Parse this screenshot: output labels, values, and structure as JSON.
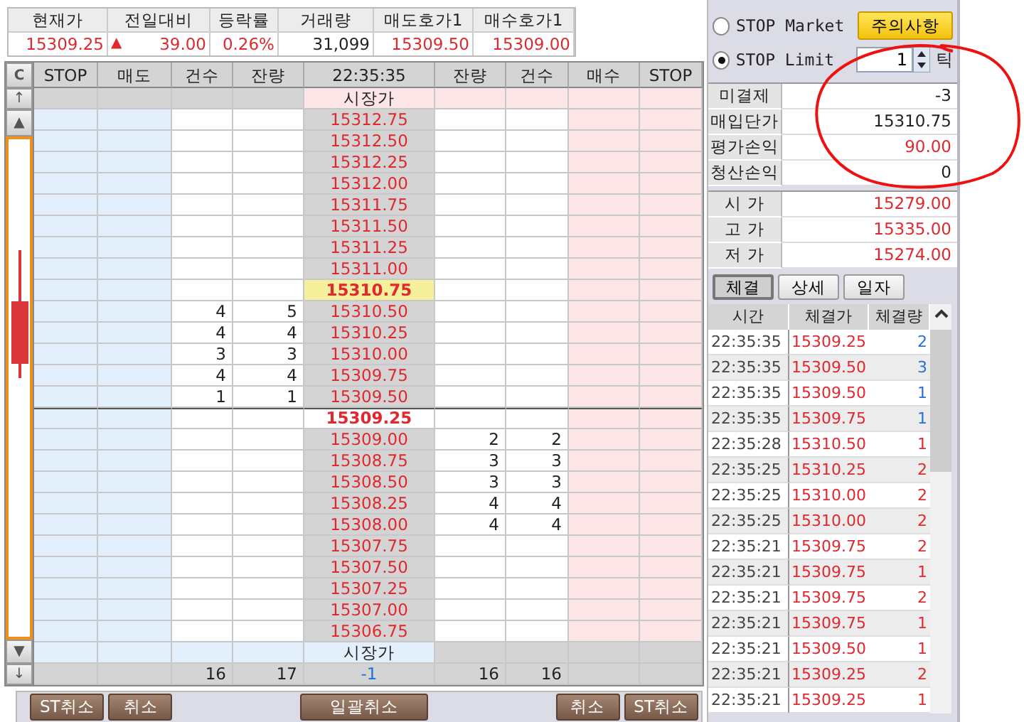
{
  "summary": {
    "columns": [
      "현재가",
      "전일대비",
      "등락률",
      "거래량",
      "매도호가1",
      "매수호가1"
    ],
    "values": [
      {
        "text": "15309.25",
        "color": "#e0282e"
      },
      {
        "text": "39.00",
        "color": "#e0282e",
        "arrow": "▲"
      },
      {
        "text": "0.26%",
        "color": "#e0282e"
      },
      {
        "text": "31,099",
        "color": "#222222"
      },
      {
        "text": "15309.50",
        "color": "#e0282e"
      },
      {
        "text": "15309.00",
        "color": "#e0282e"
      }
    ]
  },
  "order_book": {
    "clear_button": "C",
    "columns": [
      "STOP",
      "매도",
      "건수",
      "잔량",
      "22:35:35",
      "잔량",
      "건수",
      "매수",
      "STOP"
    ],
    "nav": {
      "top": "↑",
      "up": "▲",
      "down": "▼",
      "bottom": "↓"
    },
    "rows": [
      {
        "kind": "market_top",
        "label": "시장가"
      },
      {
        "kind": "price",
        "price": "15312.75",
        "marked": false
      },
      {
        "kind": "price",
        "price": "15312.50",
        "marked": false
      },
      {
        "kind": "price",
        "price": "15312.25",
        "marked": false
      },
      {
        "kind": "price",
        "price": "15312.00",
        "marked": false
      },
      {
        "kind": "price",
        "price": "15311.75",
        "marked": false
      },
      {
        "kind": "price",
        "price": "15311.50",
        "marked": false
      },
      {
        "kind": "price",
        "price": "15311.25",
        "marked": false
      },
      {
        "kind": "price",
        "price": "15311.00",
        "marked": false
      },
      {
        "kind": "price",
        "price": "15310.75",
        "marked": true
      },
      {
        "kind": "price",
        "price": "15310.50",
        "marked": false,
        "sell_count": "4",
        "sell_qty": "5"
      },
      {
        "kind": "price",
        "price": "15310.25",
        "marked": false,
        "sell_count": "4",
        "sell_qty": "4"
      },
      {
        "kind": "price",
        "price": "15310.00",
        "marked": false,
        "sell_count": "3",
        "sell_qty": "3"
      },
      {
        "kind": "price",
        "price": "15309.75",
        "marked": false,
        "sell_count": "4",
        "sell_qty": "4"
      },
      {
        "kind": "price",
        "price": "15309.50",
        "marked": false,
        "sell_count": "1",
        "sell_qty": "1"
      },
      {
        "kind": "current",
        "price": "15309.25"
      },
      {
        "kind": "price",
        "price": "15309.00",
        "marked": false,
        "buy_qty": "2",
        "buy_count": "2"
      },
      {
        "kind": "price",
        "price": "15308.75",
        "marked": false,
        "buy_qty": "3",
        "buy_count": "3"
      },
      {
        "kind": "price",
        "price": "15308.50",
        "marked": false,
        "buy_qty": "3",
        "buy_count": "3"
      },
      {
        "kind": "price",
        "price": "15308.25",
        "marked": false,
        "buy_qty": "4",
        "buy_count": "4"
      },
      {
        "kind": "price",
        "price": "15308.00",
        "marked": false,
        "buy_qty": "4",
        "buy_count": "4"
      },
      {
        "kind": "price",
        "price": "15307.75",
        "marked": false
      },
      {
        "kind": "price",
        "price": "15307.50",
        "marked": false
      },
      {
        "kind": "price",
        "price": "15307.25",
        "marked": false
      },
      {
        "kind": "price",
        "price": "15307.00",
        "marked": false
      },
      {
        "kind": "price",
        "price": "15306.75",
        "marked": false
      },
      {
        "kind": "market_bottom",
        "label": "시장가"
      },
      {
        "kind": "total",
        "sell_count": "16",
        "sell_qty": "17",
        "net": "-1",
        "buy_qty": "16",
        "buy_count": "16"
      }
    ]
  },
  "bottom_buttons": {
    "left": [
      "ST취소",
      "취소"
    ],
    "center": "일괄취소",
    "right": [
      "취소",
      "ST취소"
    ]
  },
  "stop_orders": [
    {
      "label": "STOP Market",
      "selected": false
    },
    {
      "label": "STOP Limit",
      "selected": true
    }
  ],
  "notice_button": "주의사항",
  "tick": {
    "value": "1",
    "unit": "틱"
  },
  "position": [
    {
      "label": "미결제",
      "value": "-3",
      "color": "#222222"
    },
    {
      "label": "매입단가",
      "value": "15310.75",
      "color": "#222222"
    },
    {
      "label": "평가손익",
      "value": "90.00",
      "color": "#e0282e"
    },
    {
      "label": "청산손익",
      "value": "0",
      "color": "#222222"
    }
  ],
  "prices": [
    {
      "label": "시 가",
      "value": "15279.00",
      "color": "#e0282e"
    },
    {
      "label": "고 가",
      "value": "15335.00",
      "color": "#e0282e"
    },
    {
      "label": "저 가",
      "value": "15274.00",
      "color": "#e0282e"
    }
  ],
  "tabs": [
    {
      "label": "체결",
      "selected": true
    },
    {
      "label": "상세",
      "selected": false
    },
    {
      "label": "일자",
      "selected": false
    }
  ],
  "trades": {
    "columns": [
      "시간",
      "체결가",
      "체결량"
    ],
    "rows": [
      {
        "time": "22:35:35",
        "price": "15309.25",
        "qty": "2",
        "color": "#2a6fd8"
      },
      {
        "time": "22:35:35",
        "price": "15309.50",
        "qty": "3",
        "color": "#2a6fd8"
      },
      {
        "time": "22:35:35",
        "price": "15309.50",
        "qty": "1",
        "color": "#2a6fd8"
      },
      {
        "time": "22:35:35",
        "price": "15309.75",
        "qty": "1",
        "color": "#2a6fd8"
      },
      {
        "time": "22:35:28",
        "price": "15310.50",
        "qty": "1",
        "color": "#e0282e"
      },
      {
        "time": "22:35:25",
        "price": "15310.25",
        "qty": "2",
        "color": "#e0282e"
      },
      {
        "time": "22:35:25",
        "price": "15310.00",
        "qty": "2",
        "color": "#e0282e"
      },
      {
        "time": "22:35:25",
        "price": "15310.00",
        "qty": "2",
        "color": "#e0282e"
      },
      {
        "time": "22:35:21",
        "price": "15309.75",
        "qty": "2",
        "color": "#e0282e"
      },
      {
        "time": "22:35:21",
        "price": "15309.75",
        "qty": "1",
        "color": "#e0282e"
      },
      {
        "time": "22:35:21",
        "price": "15309.75",
        "qty": "2",
        "color": "#e0282e"
      },
      {
        "time": "22:35:21",
        "price": "15309.75",
        "qty": "1",
        "color": "#e0282e"
      },
      {
        "time": "22:35:21",
        "price": "15309.50",
        "qty": "1",
        "color": "#e0282e"
      },
      {
        "time": "22:35:21",
        "price": "15309.25",
        "qty": "2",
        "color": "#e0282e"
      },
      {
        "time": "22:35:21",
        "price": "15309.25",
        "qty": "1",
        "color": "#e0282e"
      }
    ]
  }
}
